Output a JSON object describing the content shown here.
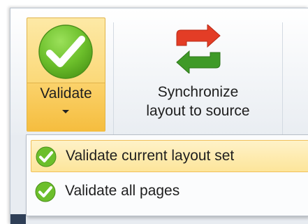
{
  "ribbon": {
    "validate": {
      "label": "Validate",
      "icon": "big-check-icon"
    },
    "synchronize": {
      "line1": "Synchronize",
      "line2": "layout to source",
      "icon": "sync-arrows-icon"
    }
  },
  "menu": {
    "items": [
      {
        "label": "Validate current layout set",
        "icon": "check-icon",
        "highlighted": true
      },
      {
        "label": "Validate all pages",
        "icon": "check-icon",
        "highlighted": false
      }
    ]
  },
  "colors": {
    "check_green": "#6cbf2b",
    "sync_red": "#e33d26",
    "sync_green": "#3f9a28",
    "highlight": "#fde59a"
  }
}
